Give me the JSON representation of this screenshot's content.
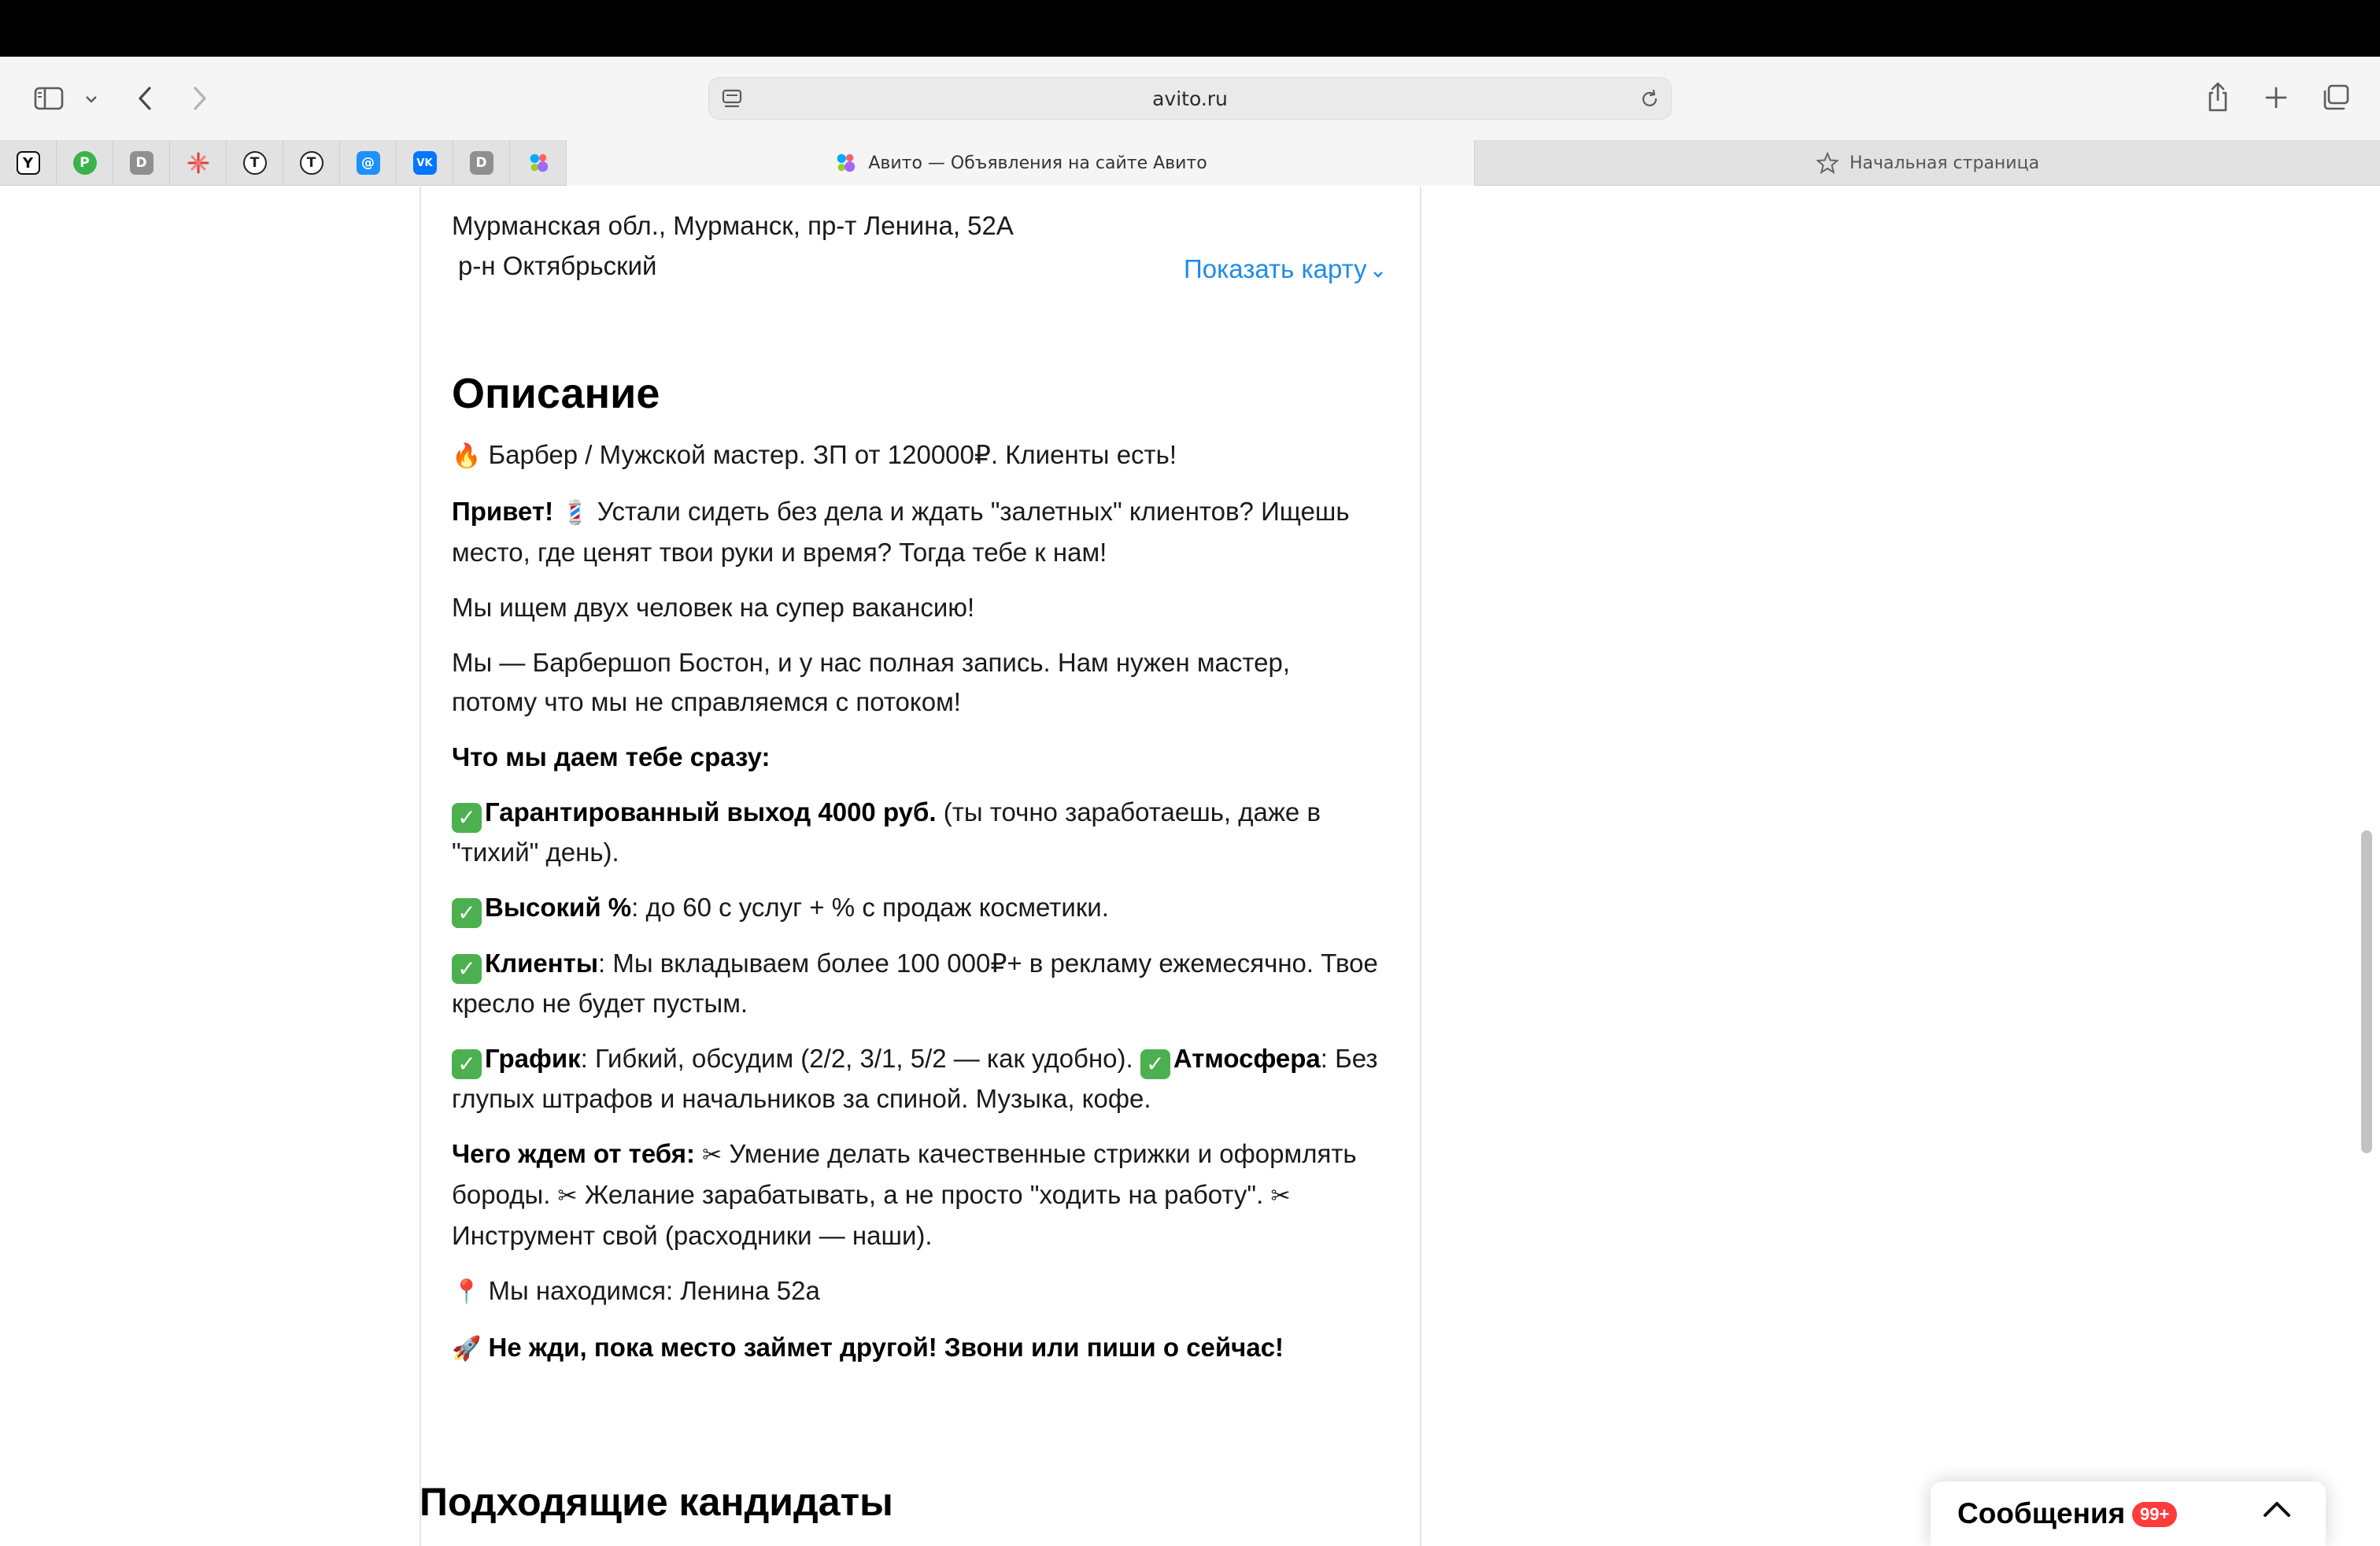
{
  "browser": {
    "url": "avito.ru",
    "active_tab_title": "Авито — Объявления на сайте Авито",
    "inactive_tab_title": "Начальная страница",
    "favorites": [
      {
        "icon": "yandex-icon",
        "letter": "Y",
        "color": "#111111"
      },
      {
        "icon": "green-p-icon",
        "letter": "P",
        "color": "#3cb34a"
      },
      {
        "icon": "d-icon",
        "letter": "D",
        "color": "#8a8a8a"
      },
      {
        "icon": "sber-icon",
        "letter": "✸",
        "color": "#e23b3b"
      },
      {
        "icon": "t-circle-icon",
        "letter": "T",
        "color": "#ffffff"
      },
      {
        "icon": "t-circle-icon",
        "letter": "T",
        "color": "#ffffff"
      },
      {
        "icon": "mail-at-icon",
        "letter": "@",
        "color": "#1e90ff"
      },
      {
        "icon": "vk-icon",
        "letter": "VK",
        "color": "#0077ff"
      },
      {
        "icon": "d-icon",
        "letter": "D",
        "color": "#8a8a8a"
      },
      {
        "icon": "avito-icon",
        "letter": "",
        "color": "#ffffff"
      }
    ]
  },
  "listing": {
    "address_line1": "Мурманская обл., Мурманск, пр-т Ленина, 52А",
    "address_line2": "р-н Октябрьский",
    "show_map": "Показать карту",
    "description_heading": "Описание",
    "description": {
      "p1_emoji": "🔥",
      "p1_text": " Барбер / Мужской мастер. ЗП от 120000₽. Клиенты есть!",
      "p2_bold": "Привет!",
      "p2_emoji": "💈",
      "p2_text": " Устали сидеть без дела и ждать \"залетных\" клиентов? Ищешь место, где ценят твои руки и время? Тогда тебе к нам!",
      "p3_text": "Мы ищем двух человек на супер вакансию!",
      "p4_text": "Мы — Барбершоп Бостон, и у нас полная запись. Нам нужен мастер, потому что мы не справляемся с потоком!",
      "p5_bold": "Что мы даем тебе сразу:",
      "p6_bold": "Гарантированный выход 4000 руб.",
      "p6_text": " (ты точно заработаешь, даже в \"тихий\" день).",
      "p7_bold": "Высокий %",
      "p7_text": ": до 60 с услуг + % с продаж косметики.",
      "p8_bold": "Клиенты",
      "p8_text": ": Мы вкладываем более 100 000₽+ в рекламу ежемесячно. Твое кресло не будет пустым.",
      "p9_bold1": "График",
      "p9_text1": ": Гибкий, обсудим (2/2, 3/1, 5/2 — как удобно). ",
      "p9_bold2": "Атмосфера",
      "p9_text2": ": Без глупых штрафов и начальников за спиной. Музыка, кофе.",
      "p10_bold": "Чего ждем от тебя:",
      "p10_text1": " Умение делать качественные стрижки и оформлять бороды. ",
      "p10_text2": " Желание зарабатывать, а не просто \"ходить на работу\". ",
      "p10_text3": " Инструмент свой (расходники — наши).",
      "scissors": "✂",
      "p11_emoji": "📍",
      "p11_text": " Мы находимся: Ленина 52а",
      "p12_emoji": "🚀",
      "p12_bold": " Не жди, пока место займет другой! Звони или пиши о сейчас!",
      "check": "✓"
    },
    "candidates_heading": "Подходящие кандидаты"
  },
  "messages": {
    "label": "Сообщения",
    "badge": "99+"
  },
  "colors": {
    "link": "#1f8ce8",
    "check_green": "#4cb050",
    "badge_red": "#ff3b3b"
  }
}
